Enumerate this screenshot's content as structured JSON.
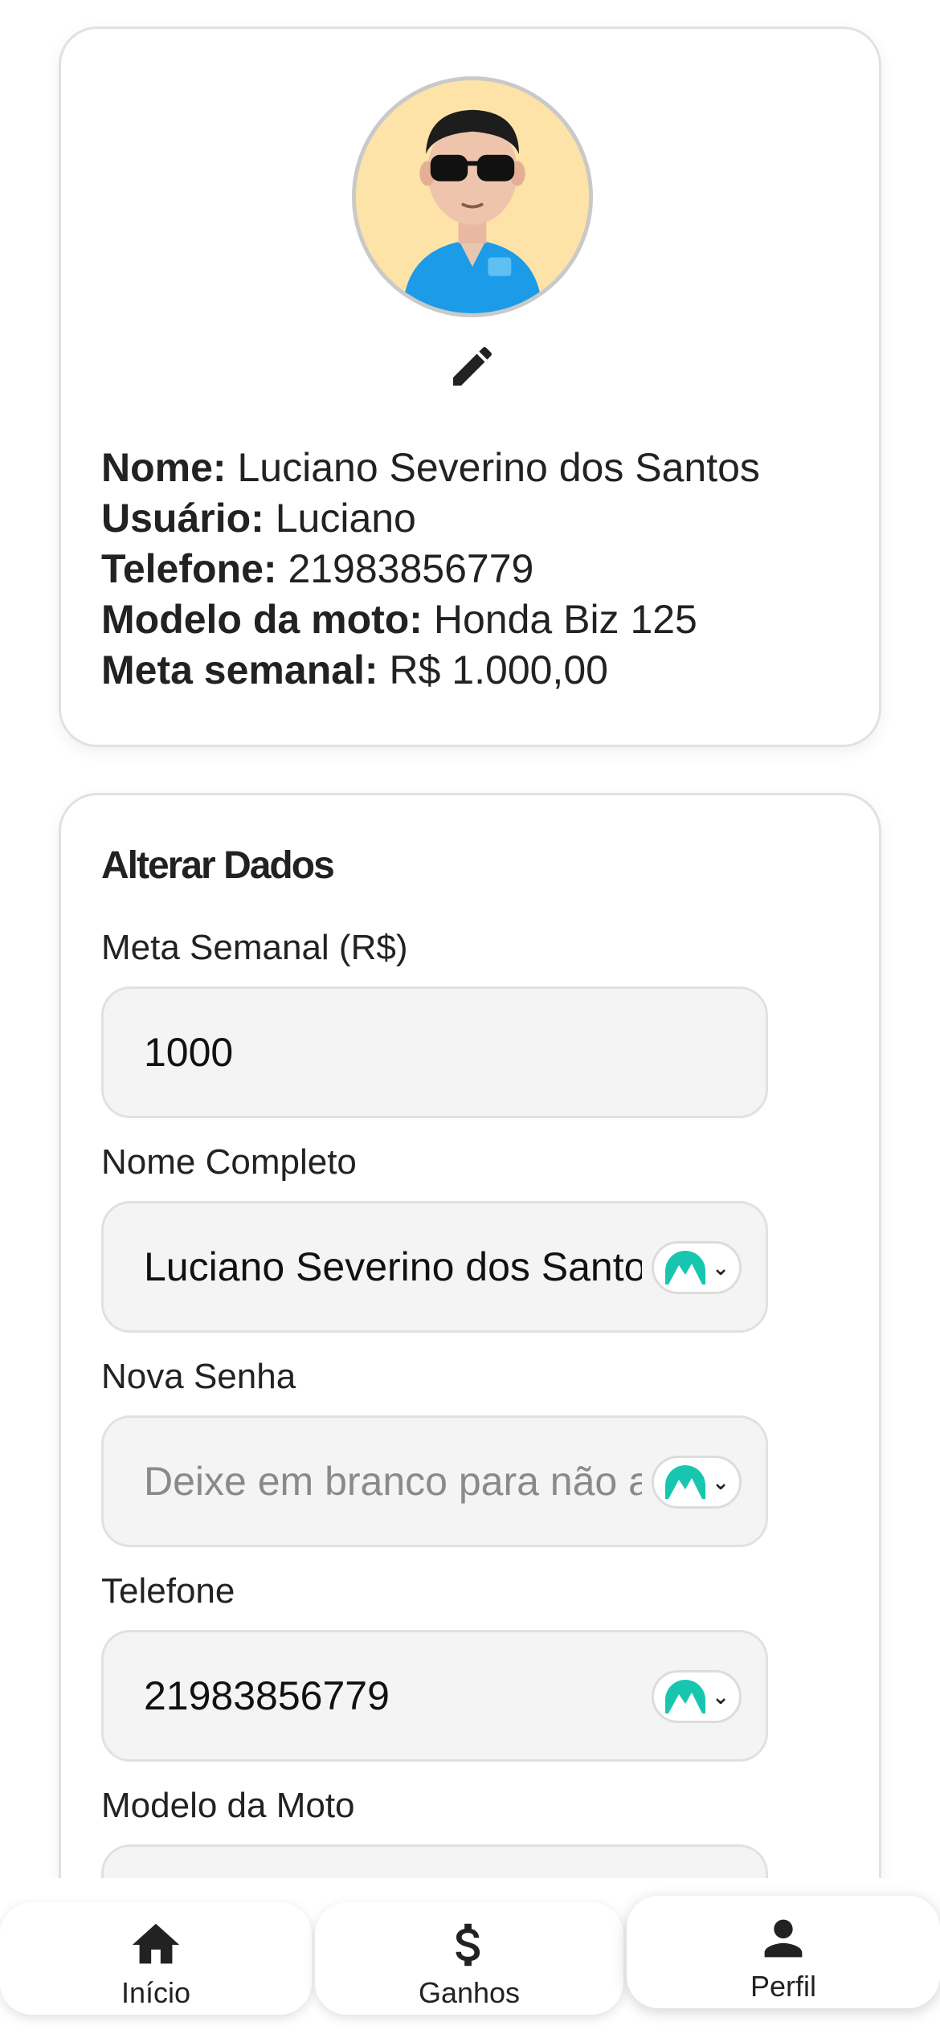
{
  "profile": {
    "fields": [
      {
        "label": "Nome:",
        "value": "Luciano Severino dos Santos"
      },
      {
        "label": "Usuário:",
        "value": "Luciano"
      },
      {
        "label": "Telefone:",
        "value": "21983856779"
      },
      {
        "label": "Modelo da moto:",
        "value": "Honda Biz 125"
      },
      {
        "label": "Meta semanal:",
        "value": "R$ 1.000,00"
      }
    ],
    "avatar_icon": "avatar-memoji",
    "edit_icon": "pencil-icon"
  },
  "form": {
    "title": "Alterar Dados",
    "meta": {
      "label": "Meta Semanal (R$)",
      "value": "1000"
    },
    "nome": {
      "label": "Nome Completo",
      "value": "Luciano Severino dos Santos"
    },
    "senha": {
      "label": "Nova Senha",
      "placeholder": "Deixe em branco para não alterar"
    },
    "telefone": {
      "label": "Telefone",
      "value": "21983856779"
    },
    "moto": {
      "label": "Modelo da Moto"
    }
  },
  "nav": {
    "items": [
      {
        "label": "Início",
        "icon": "home-icon"
      },
      {
        "label": "Ganhos",
        "icon": "dollar-icon"
      },
      {
        "label": "Perfil",
        "icon": "person-icon"
      }
    ],
    "active": "Perfil"
  },
  "colors": {
    "password_manager": "#18c6b0",
    "card_border": "#e1e1e1",
    "field_bg": "#f4f4f4"
  }
}
